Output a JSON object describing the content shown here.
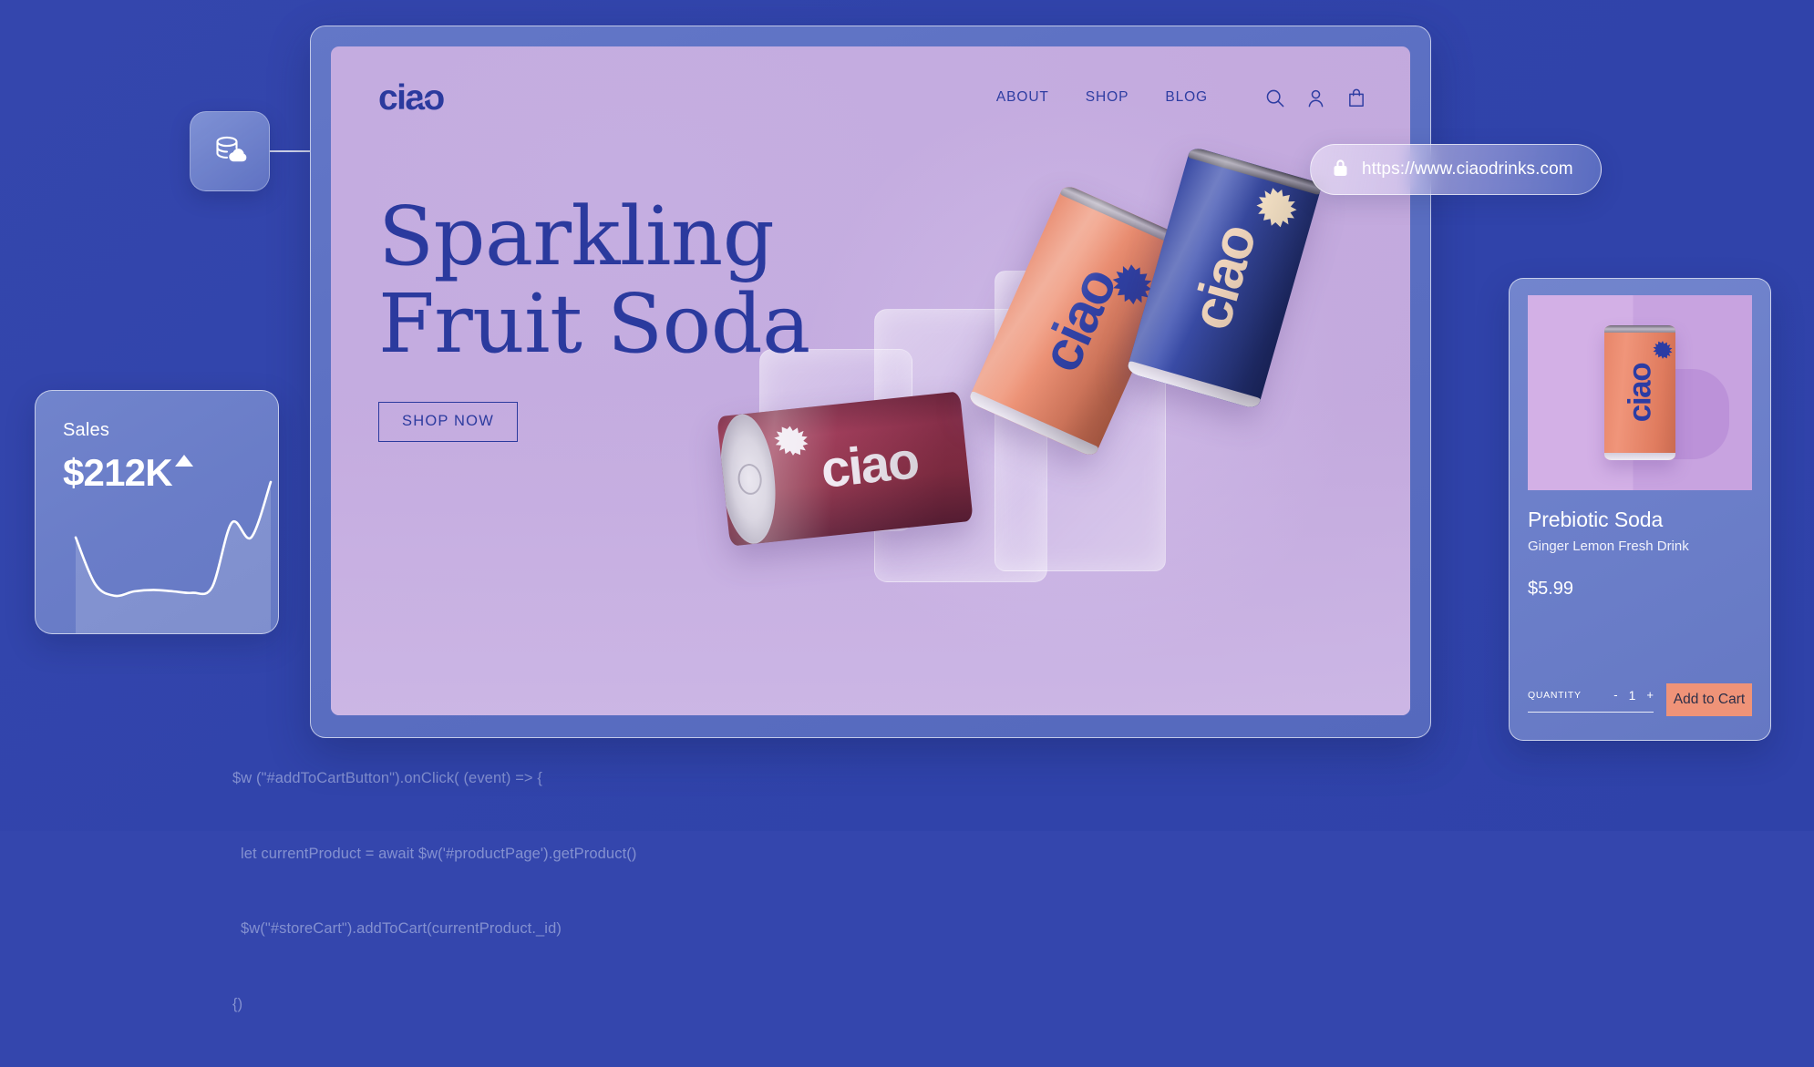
{
  "background": {
    "color": "#3446ad"
  },
  "code_overlay": {
    "lines": [
      "$w (\"#addToCartButton\").onClick( (event) => {",
      "let currentProduct = await $w('#productPage').getProduct()",
      "$w(\"#storeCart\").addToCart(currentProduct._id)",
      "{)"
    ]
  },
  "db_node": {
    "icon": "database-cloud-icon"
  },
  "url_bar": {
    "lock_icon": "lock-icon",
    "url": "https://www.ciaodrinks.com"
  },
  "browser": {
    "site": {
      "logo": "ciao",
      "nav": [
        {
          "label": "ABOUT",
          "name": "nav-link-about"
        },
        {
          "label": "SHOP",
          "name": "nav-link-shop"
        },
        {
          "label": "BLOG",
          "name": "nav-link-blog"
        }
      ],
      "icons": [
        {
          "name": "search-icon"
        },
        {
          "name": "user-icon"
        },
        {
          "name": "shopping-bag-icon"
        }
      ],
      "hero": {
        "title_line1": "Sparkling",
        "title_line2": "Fruit Soda",
        "cta_label": "SHOP NOW"
      },
      "cans": [
        {
          "name": "can-orange",
          "word": "ciao",
          "color": "#e8886b"
        },
        {
          "name": "can-blue",
          "word": "ciao",
          "color": "#2b3d9c"
        },
        {
          "name": "can-maroon",
          "word": "ciao",
          "color": "#8e3049"
        }
      ]
    }
  },
  "sales_card": {
    "label": "Sales",
    "value": "$212K",
    "trend": "up"
  },
  "product_card": {
    "title": "Prebiotic Soda",
    "subtitle": "Ginger Lemon Fresh Drink",
    "price": "$5.99",
    "quantity_label": "QUANTITY",
    "decrement": "-",
    "quantity_value": "1",
    "increment": "+",
    "add_to_cart_label": "Add to Cart",
    "accent_color": "#ef9378",
    "image_can_word": "ciao"
  },
  "chart_data": {
    "type": "area",
    "title": "Sales",
    "value_label": "$212K",
    "x": [
      0,
      1,
      2,
      3,
      4,
      5,
      6,
      7,
      8,
      9,
      10
    ],
    "values": [
      62,
      30,
      22,
      25,
      26,
      25,
      24,
      28,
      72,
      62,
      100
    ],
    "xlabel": "",
    "ylabel": "",
    "ylim": [
      0,
      100
    ],
    "grid": false,
    "legend": false,
    "line_color": "#ffffff",
    "fill_color": "rgba(255,255,255,0.18)"
  }
}
